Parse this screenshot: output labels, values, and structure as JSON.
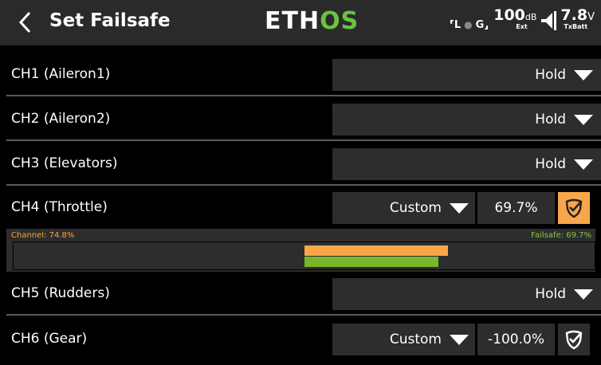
{
  "header": {
    "title": "Set Failsafe",
    "logo": {
      "left": "ETH",
      "right": "OS"
    },
    "status": {
      "left_indicator": "⸢L",
      "gps_indicator": "G⸥",
      "rssi": "100",
      "rssi_unit": "dB",
      "rssi_sub": "Ext",
      "battery": "7.8",
      "battery_unit": "V",
      "battery_sub": "TxBatt"
    }
  },
  "channels": [
    {
      "label": "CH1 (Aileron1)",
      "mode": "Hold"
    },
    {
      "label": "CH2 (Aileron2)",
      "mode": "Hold"
    },
    {
      "label": "CH3 (Elevators)",
      "mode": "Hold"
    },
    {
      "label": "CH4 (Throttle)",
      "mode": "Custom",
      "value": "69.7%"
    },
    {
      "label": "CH5 (Rudders)",
      "mode": "Hold"
    },
    {
      "label": "CH6 (Gear)",
      "mode": "Custom",
      "value": "-100.0%"
    }
  ],
  "channel_bar": {
    "channel_label": "Channel: 74.8%",
    "failsafe_label": "Failsafe: 69.7%",
    "channel_percent": 74.8,
    "failsafe_percent": 69.7
  },
  "colors": {
    "accent_orange": "#f9a64b",
    "accent_green": "#79b629",
    "logo_green": "#69c340"
  }
}
